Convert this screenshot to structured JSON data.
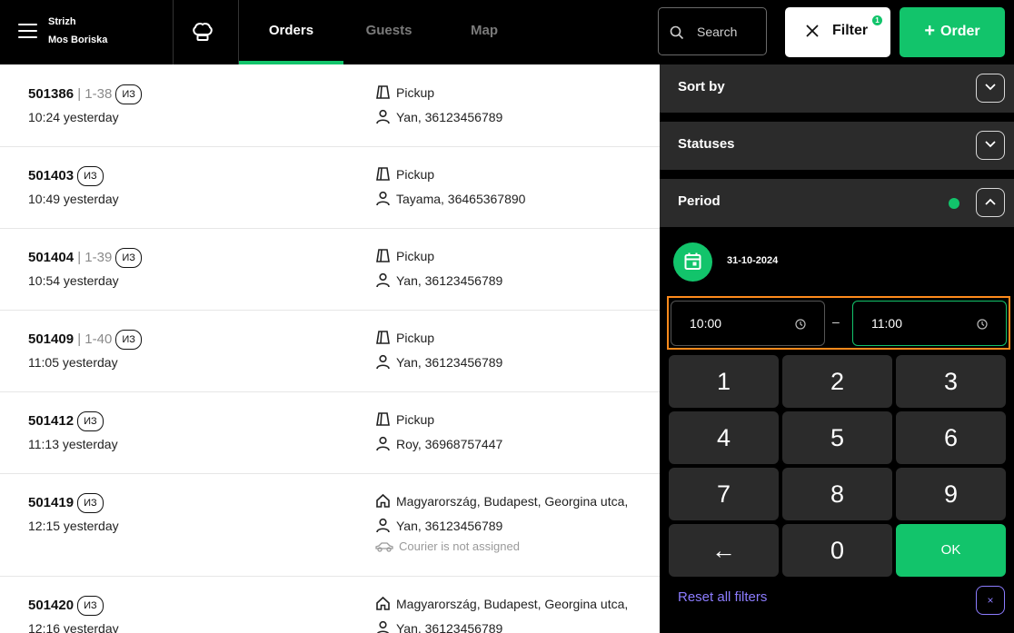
{
  "header": {
    "user_name": "Strizh",
    "location_name": "Mos Boriska",
    "tabs": [
      {
        "label": "Orders",
        "active": true
      },
      {
        "label": "Guests",
        "active": false
      },
      {
        "label": "Map",
        "active": false
      }
    ],
    "search_label": "Search",
    "filter_label": "Filter",
    "filter_badge": "1",
    "order_label": "Order",
    "order_plus": "+"
  },
  "orders": [
    {
      "number": "501386",
      "slot": "| 1-38",
      "tag": "ИЗ",
      "time": "10:24 yesterday",
      "type": "Pickup",
      "type_icon": "pickup-icon",
      "customer": "Yan, 36123456789"
    },
    {
      "number": "501403",
      "slot": "",
      "tag": "ИЗ",
      "time": "10:49 yesterday",
      "type": "Pickup",
      "type_icon": "pickup-icon",
      "customer": "Tayama, 36465367890"
    },
    {
      "number": "501404",
      "slot": "| 1-39",
      "tag": "ИЗ",
      "time": "10:54 yesterday",
      "type": "Pickup",
      "type_icon": "pickup-icon",
      "customer": "Yan, 36123456789"
    },
    {
      "number": "501409",
      "slot": "| 1-40",
      "tag": "ИЗ",
      "time": "11:05 yesterday",
      "type": "Pickup",
      "type_icon": "pickup-icon",
      "customer": "Yan, 36123456789"
    },
    {
      "number": "501412",
      "slot": "",
      "tag": "ИЗ",
      "time": "11:13 yesterday",
      "type": "Pickup",
      "type_icon": "pickup-icon",
      "customer": "Roy, 36968757447"
    },
    {
      "number": "501419",
      "slot": "",
      "tag": "ИЗ",
      "time": "12:15 yesterday",
      "type": "Magyarország, Budapest, Georgina utca,",
      "type_icon": "home-icon",
      "customer": "Yan, 36123456789",
      "courier": "Courier is not assigned"
    },
    {
      "number": "501420",
      "slot": "",
      "tag": "ИЗ",
      "time": "12:16 yesterday",
      "type": "Magyarország, Budapest, Georgina utca,",
      "type_icon": "home-icon",
      "customer": "Yan, 36123456789"
    }
  ],
  "filter_panel": {
    "sort_by": "Sort by",
    "statuses": "Statuses",
    "period": "Period",
    "date": "31-10-2024",
    "time_from": "10:00",
    "time_to": "11:00",
    "time_separator": "–",
    "keypad": [
      "1",
      "2",
      "3",
      "4",
      "5",
      "6",
      "7",
      "8",
      "9",
      "←",
      "0",
      "OK"
    ],
    "reset_label": "Reset all filters",
    "reset_x": "×"
  },
  "colors": {
    "accent": "#12c46b",
    "highlight": "#ff8a1c",
    "link": "#8c7cff",
    "panel_bg": "#000000",
    "section_bg": "#2b2b2b"
  }
}
